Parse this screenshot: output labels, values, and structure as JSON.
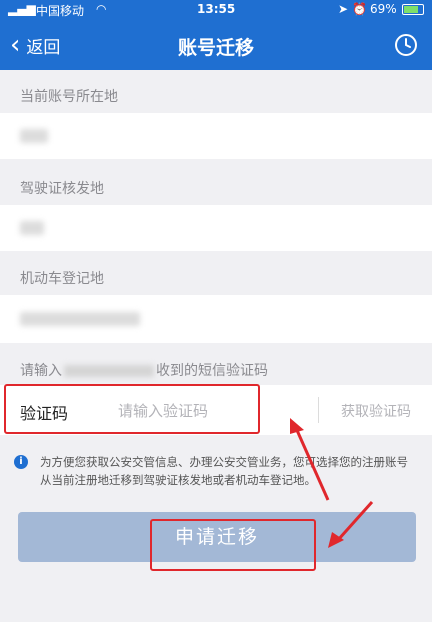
{
  "status_bar": {
    "carrier": "中国移动",
    "time": "13:55",
    "battery": "69%"
  },
  "nav": {
    "back_label": "返回",
    "title": "账号迁移",
    "history_icon": "clock-icon"
  },
  "sections": {
    "current_location_label": "当前账号所在地",
    "license_issue_label": "驾驶证核发地",
    "vehicle_reg_label": "机动车登记地"
  },
  "sms_prompt": {
    "prefix": "请输入",
    "suffix": "收到的短信验证码"
  },
  "code_row": {
    "label": "验证码",
    "placeholder": "请输入验证码",
    "value": "",
    "get_code_label": "获取验证码"
  },
  "notice": {
    "text": "为方便您获取公安交管信息、办理公安交管业务，您可选择您的注册账号从当前注册地迁移到驾驶证核发地或者机动车登记地。"
  },
  "apply_button": {
    "label": "申请迁移"
  },
  "colors": {
    "brand_blue": "#1f6fd1",
    "annotation_red": "#e0272c",
    "button_disabled": "#a3b8d6"
  }
}
